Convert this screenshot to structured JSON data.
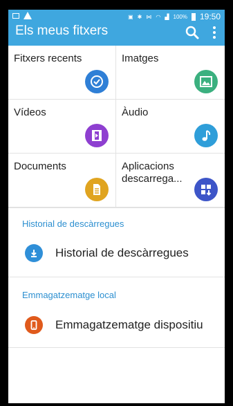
{
  "status_bar": {
    "battery": "100%",
    "time": "19:50"
  },
  "app_bar": {
    "title": "Els meus fitxers"
  },
  "tiles": [
    {
      "label": "Fitxers recents",
      "icon": "clock-icon",
      "color": "#2f7fd6"
    },
    {
      "label": "Imatges",
      "icon": "image-icon",
      "color": "#3bb07f"
    },
    {
      "label": "Vídeos",
      "icon": "film-icon",
      "color": "#8e3fd0"
    },
    {
      "label": "Àudio",
      "icon": "music-note-icon",
      "color": "#2f9ed9"
    },
    {
      "label": "Documents",
      "icon": "document-icon",
      "color": "#e0a420"
    },
    {
      "label": "Aplicacions descarrega...",
      "icon": "app-download-icon",
      "color": "#3d55c8"
    }
  ],
  "sections": [
    {
      "heading": "Historial de descàrregues",
      "item_label": "Historial de descàrregues",
      "icon": "download-icon",
      "color": "#2f8fd8"
    },
    {
      "heading": "Emmagatzematge local",
      "item_label": "Emmagatzematge dispositiu",
      "icon": "phone-icon",
      "color": "#e05a1c"
    }
  ],
  "colors": {
    "app_bar": "#3fa7df",
    "accent": "#2c8fd0"
  }
}
